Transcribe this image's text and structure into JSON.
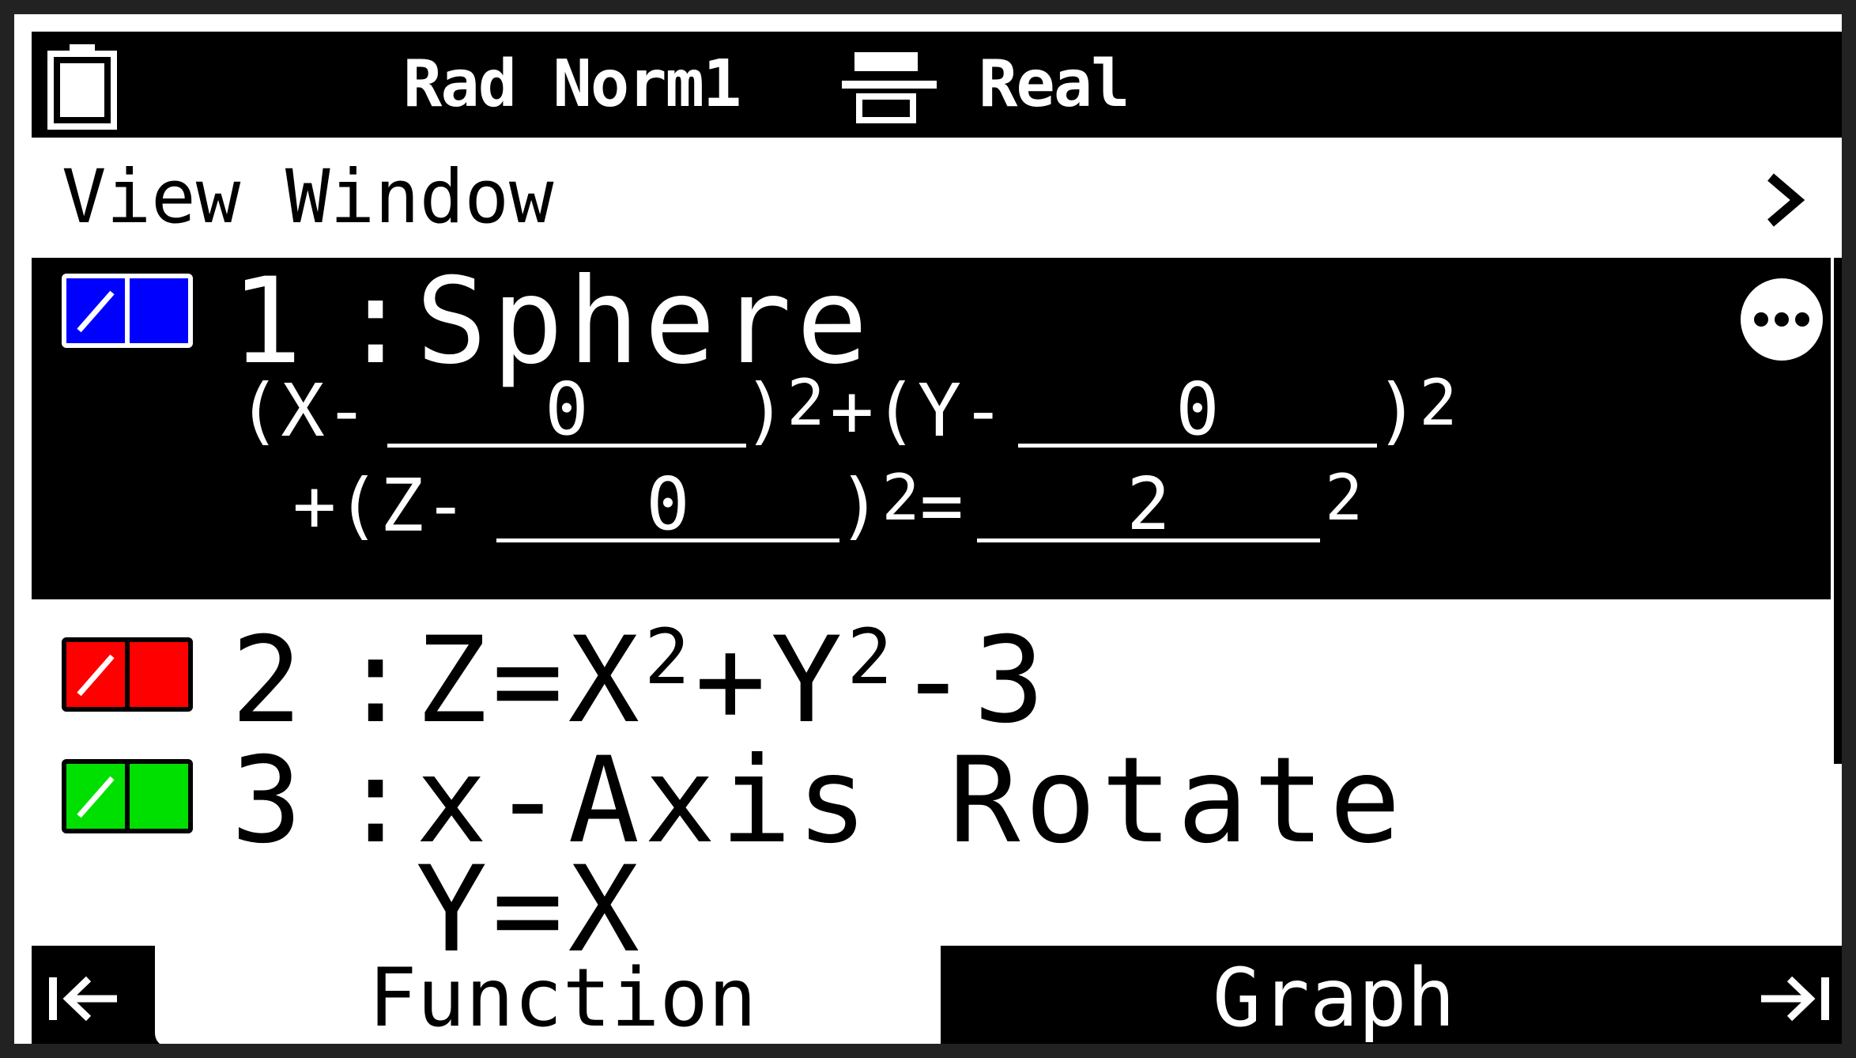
{
  "statusbar": {
    "battery_icon": "battery-icon",
    "angle_mode": "Rad Norm1",
    "display_icon": "math-input-display-icon",
    "complex_mode": "Real"
  },
  "view_window": {
    "label": "View Window",
    "chevron": ">"
  },
  "functions": [
    {
      "number": "1",
      "colon": ":",
      "name": "Sphere",
      "color": "#0000ff",
      "selected": true,
      "equation": {
        "x_prefix": "(X-",
        "x_center": "0",
        "x_suffix": ")",
        "x_exp": "2",
        "plus_y_prefix": "+(Y-",
        "y_center": "0",
        "y_suffix": ")",
        "y_exp": "2",
        "plus_z_prefix": "+(Z-",
        "z_center": "0",
        "z_suffix": ")",
        "z_exp": "2",
        "equals": "=",
        "radius": "2",
        "r_exp": "2"
      },
      "more_icon": "more-options-icon"
    },
    {
      "number": "2",
      "colon": ":",
      "name_parts": {
        "a": "Z=X",
        "a_exp": "2",
        "b": "+Y",
        "b_exp": "2",
        "c": "-3"
      },
      "color": "#ff0000",
      "selected": false
    },
    {
      "number": "3",
      "colon": ":",
      "name": "x-Axis Rotate",
      "sub": "Y=X",
      "color": "#00e000",
      "selected": false
    }
  ],
  "tabs": {
    "first_icon": "first-page-icon",
    "function": "Function",
    "graph": "Graph",
    "last_icon": "last-page-icon"
  }
}
